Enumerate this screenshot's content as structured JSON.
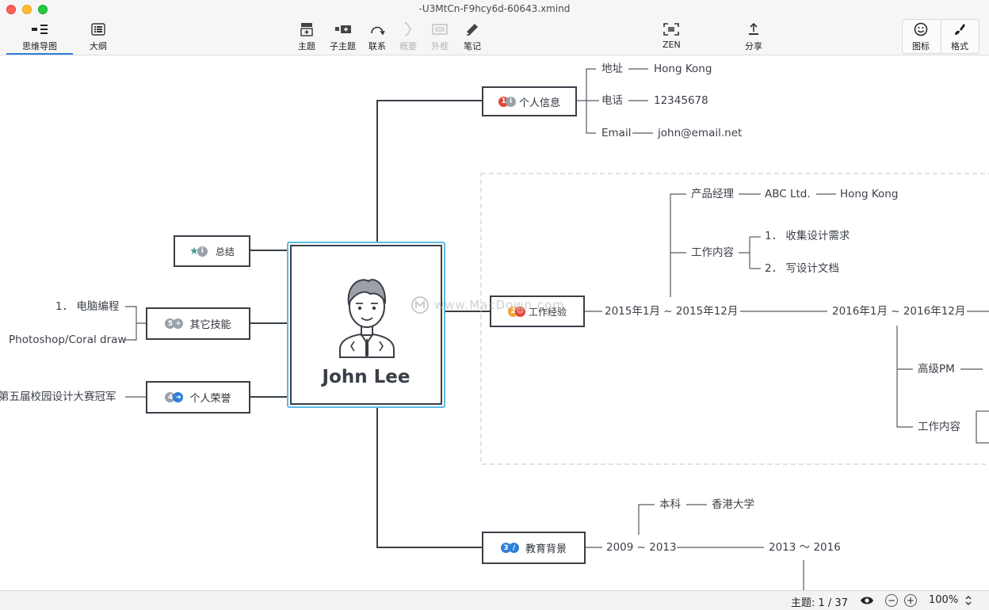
{
  "window": {
    "title": "-U3MtCn-F9hcy6d-60643.xmind"
  },
  "toolbar": {
    "views": [
      {
        "label": "思维导图",
        "icon": "mindmap-icon"
      },
      {
        "label": "大纲",
        "icon": "outline-icon"
      }
    ],
    "insert": [
      {
        "label": "主题",
        "icon": "topic-icon",
        "enabled": true
      },
      {
        "label": "子主题",
        "icon": "subtopic-icon",
        "enabled": true
      },
      {
        "label": "联系",
        "icon": "relationship-icon",
        "enabled": true
      },
      {
        "label": "概要",
        "icon": "summary-icon",
        "enabled": false
      },
      {
        "label": "外框",
        "icon": "boundary-icon",
        "enabled": false
      },
      {
        "label": "笔记",
        "icon": "notes-icon",
        "enabled": true
      }
    ],
    "zen": {
      "label": "ZEN"
    },
    "share": {
      "label": "分享"
    },
    "icons": {
      "label": "图标"
    },
    "format": {
      "label": "格式"
    }
  },
  "mindmap": {
    "central": {
      "name": "John Lee"
    },
    "personal": {
      "title": "个人信息",
      "items": [
        {
          "key": "地址",
          "value": "Hong Kong"
        },
        {
          "key": "电话",
          "value": "12345678"
        },
        {
          "key": "Email",
          "value": "john@email.net"
        }
      ]
    },
    "summary": {
      "title": "总结"
    },
    "skills": {
      "title": "其它技能",
      "items": [
        "1．  电脑编程",
        "Photoshop/Coral draw"
      ]
    },
    "honors": {
      "title": "个人荣誉",
      "items": [
        "第五届校园设计大赛冠军"
      ]
    },
    "work": {
      "title": "工作经验",
      "period1": {
        "label": "2015年1月 ~ 2015年12月",
        "role": "产品经理",
        "company": "ABC Ltd.",
        "location": "Hong Kong",
        "content_label": "工作内容",
        "content": [
          "1．  收集设计需求",
          "2．  写设计文档"
        ]
      },
      "period2": {
        "label": "2016年1月 ~ 2016年12月",
        "role": "高级PM",
        "content_label": "工作内容"
      }
    },
    "education": {
      "title": "教育背景",
      "period1": {
        "label": "2009 ~ 2013",
        "degree": "本科",
        "school": "香港大学"
      },
      "period2": {
        "label": "2013 ～ 2016"
      }
    }
  },
  "watermark": "www.MacDown.com",
  "status": {
    "topic_count": "主题: 1 / 37",
    "zoom": "100%"
  },
  "colors": {
    "accent": "#2f7ed8",
    "selection": "#5bbbe4",
    "line": "#3a3f47",
    "marker_red": "#e0453b",
    "marker_blue": "#2f7ed8",
    "marker_green": "#38a18e"
  }
}
